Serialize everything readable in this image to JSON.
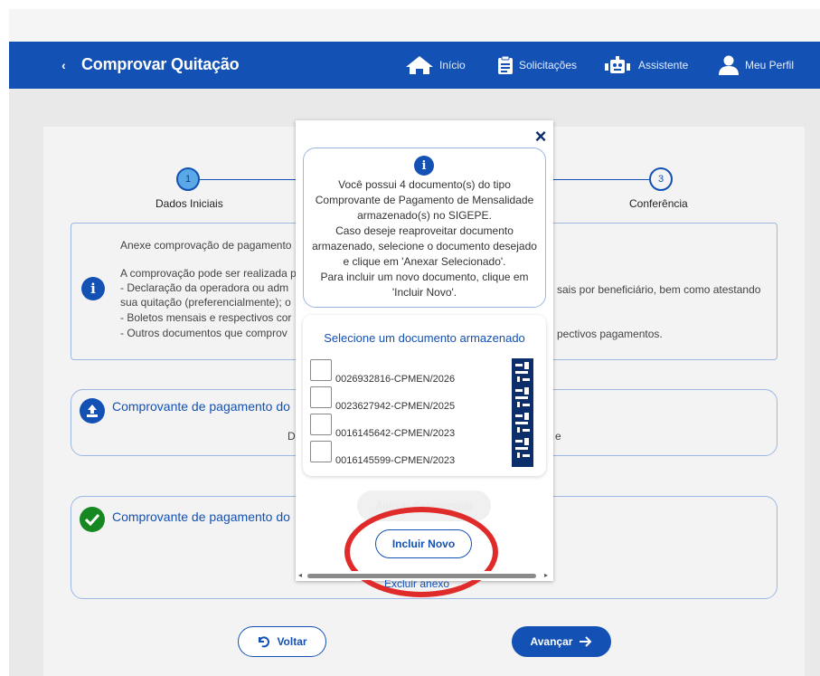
{
  "header": {
    "back_icon": "chevron-left-icon",
    "back_glyph": "‹",
    "title": "Comprovar Quitação",
    "nav": [
      {
        "label": "Início",
        "icon": "home-icon"
      },
      {
        "label": "Solicitações",
        "icon": "clipboard-icon"
      },
      {
        "label": "Assistente",
        "icon": "robot-icon"
      },
      {
        "label": "Meu Perfil",
        "icon": "user-icon"
      }
    ]
  },
  "stepper": {
    "steps": [
      {
        "number": "1",
        "label": "Dados Iniciais",
        "active": true
      },
      {
        "number": "3",
        "label": "Conferência",
        "active": false
      }
    ]
  },
  "info": {
    "lines": [
      "Anexe comprovação de pagamento",
      "A comprovação pode ser realizada p",
      "- Declaração da operadora ou adm",
      "sua quitação (preferencialmente); o",
      "- Boletos mensais e respectivos cor",
      "- Outros documentos que comprov"
    ],
    "right_lines": [
      "sais por beneficiário, bem como atestando",
      "pectivos pagamentos."
    ]
  },
  "upload_box": {
    "title": "Comprovante de pagamento do",
    "fragment_left": "D",
    "fragment_right": "e"
  },
  "ok_box": {
    "title": "Comprovante de pagamento do"
  },
  "modal": {
    "close_glyph": "×",
    "info_lines": [
      "Você possui 4 documento(s) do tipo",
      "Comprovante de Pagamento de Mensalidade",
      "armazenado(s) no SIGEPE.",
      "Caso deseje reaproveitar documento",
      "armazenado, selecione o documento desejado",
      "e clique em 'Anexar Selecionado'.",
      "Para incluir um novo documento, clique em",
      "'Incluir Novo'."
    ],
    "select_title": "Selecione um documento armazenado",
    "documents": [
      "0026932816-CPMEN/2026",
      "0023627942-CPMEN/2025",
      "0016145642-CPMEN/2023",
      "0016145599-CPMEN/2023"
    ],
    "attach_label": "Anexar Selecionado",
    "include_label": "Incluir Novo",
    "delete_label": "Excluir anexo"
  },
  "footer": {
    "back_label": "Voltar",
    "next_label": "Avançar"
  },
  "colors": {
    "primary": "#1351b4",
    "success": "#168821",
    "highlight": "#e02b2b"
  }
}
